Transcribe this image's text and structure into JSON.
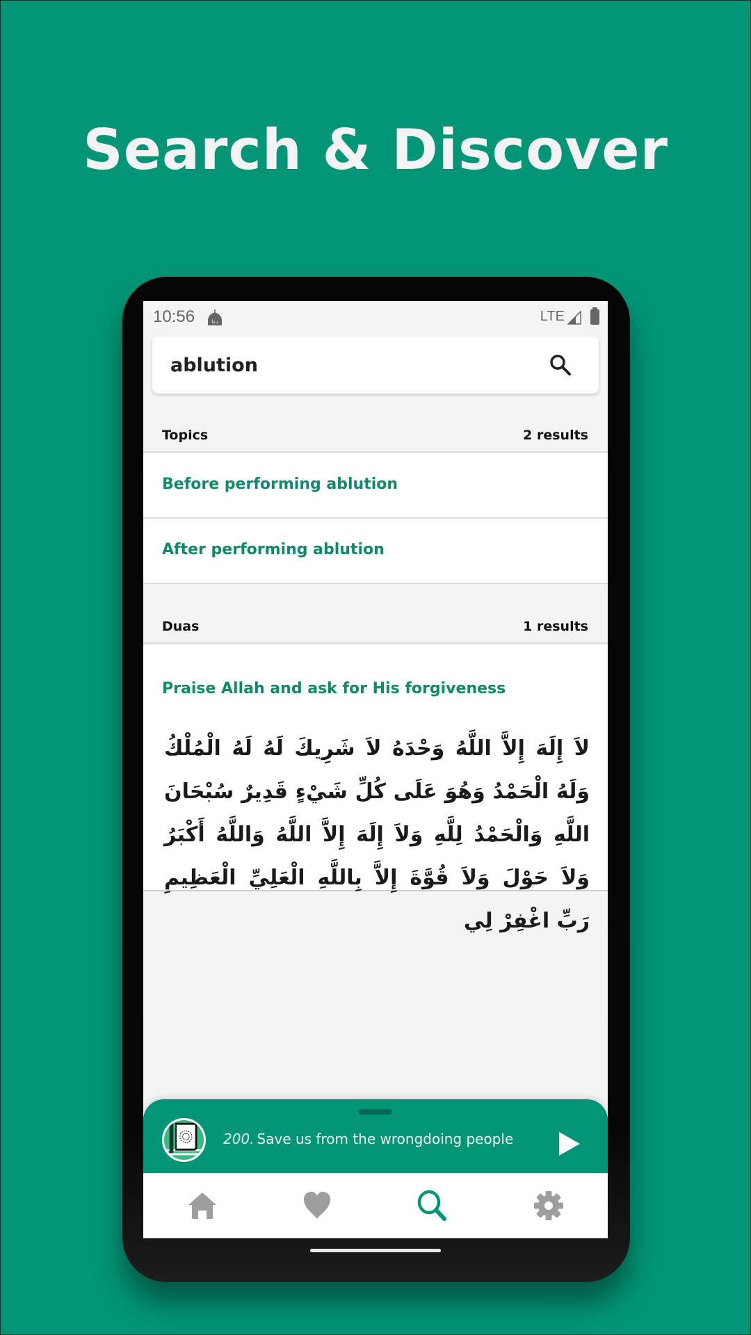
{
  "hero": {
    "title": "Search & Discover"
  },
  "colors": {
    "brand": "#029677",
    "accent_text": "#0e8a6c",
    "icon_inactive": "#9e9e9e"
  },
  "statusbar": {
    "time": "10:56",
    "app_icon": "mosque-dua-icon",
    "network": "LTE",
    "signal_icon": "signal-icon",
    "battery_icon": "battery-icon"
  },
  "search": {
    "value": "ablution",
    "icon": "search-icon"
  },
  "sections": {
    "topics": {
      "label": "Topics",
      "count": "2 results",
      "items": [
        {
          "label": "Before performing ablution"
        },
        {
          "label": "After performing ablution"
        }
      ]
    },
    "duas": {
      "label": "Duas",
      "count": "1 results",
      "items": [
        {
          "title": "Praise Allah and ask for His forgiveness",
          "arabic": "لاَ إِلَهَ إِلاَّ اللَّهُ وَحْدَهُ لاَ شَرِيكَ لَهُ لَهُ الْمُلْكُ وَلَهُ الْحَمْدُ وَهُوَ عَلَى كُلِّ شَيْءٍ قَدِيرٌ سُبْحَانَ اللَّهِ وَالْحَمْدُ لِلَّهِ وَلاَ إِلَهَ إِلاَّ اللَّهُ وَاللَّهُ أَكْبَرُ وَلاَ حَوْلَ وَلاَ قُوَّةَ إِلاَّ بِاللَّهِ الْعَلِيِّ الْعَظِيمِ رَبِّ اغْفِرْ لِي"
        }
      ]
    }
  },
  "player": {
    "number": "200.",
    "title": "Save us from the wrongdoing people",
    "art_icon": "quran-book-icon",
    "action_icon": "play-icon"
  },
  "bottom_nav": [
    {
      "name": "home",
      "icon": "home-icon",
      "active": false
    },
    {
      "name": "favorites",
      "icon": "heart-icon",
      "active": false
    },
    {
      "name": "search",
      "icon": "search-icon",
      "active": true
    },
    {
      "name": "settings",
      "icon": "gear-icon",
      "active": false
    }
  ]
}
